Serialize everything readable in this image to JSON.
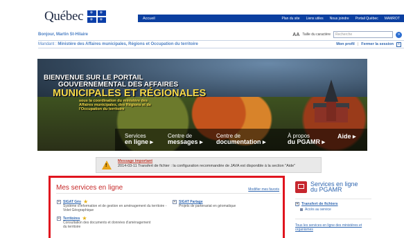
{
  "header": {
    "logo_text": "Québec",
    "home": "Accueil",
    "links": [
      "Plan du site",
      "Liens utiles",
      "Nous joindre",
      "Portail Québec",
      "MAMROT"
    ]
  },
  "userbar": {
    "greeting": "Bonjour, Martin St-Hilaire",
    "font_size_icon": "AA",
    "font_size_label": "Taille du caractère",
    "search_placeholder": "Recherche",
    "search_go": "»"
  },
  "mandat": {
    "label": "Mandant :",
    "value": "Ministère des Affaires municipales, Régions et Occupation du territoire",
    "mon_profil": "Mon profil",
    "fermer": "Fermer la session",
    "close_glyph": "x"
  },
  "banner": {
    "line1": "BIENVENUE SUR LE PORTAIL",
    "line2": "GOUVERNEMENTAL DES AFFAIRES",
    "line3": "MUNICIPALES ET RÉGIONALES",
    "sub": "sous la coordination du ministère des Affaires municipales, des Régions et de l'Occupation du territoire",
    "nav": [
      {
        "top": "Services",
        "bottom": "en ligne",
        "arrow": "▸"
      },
      {
        "top": "Centre de",
        "bottom": "messages",
        "arrow": "▸"
      },
      {
        "top": "Centre de",
        "bottom": "documentation",
        "arrow": "▸"
      },
      {
        "top": "À propos",
        "bottom": "du PGAMR",
        "arrow": "▸"
      },
      {
        "top": "",
        "bottom": "Aide",
        "arrow": "▸"
      }
    ]
  },
  "alert": {
    "title": "Message important",
    "text": "2014-03-11 Transfert de fichier : la configuration recommandée de JAVA est disponible à la section \"Aide\"",
    "icon": "!"
  },
  "services": {
    "title": "Mes services en ligne",
    "modify": "Modifier mes favoris",
    "items": [
      {
        "name": "SIGAT Géo",
        "desc": "Système d'information et de gestion en aménagement du territoire - Volet Géographique",
        "favorite": true
      },
      {
        "name": "SIGAT Partage",
        "desc": "Projets de partenariat en géomatique",
        "favorite": false
      },
      {
        "name": "Territoires",
        "desc": "Consultation des documents et données d'aménagement du territoire",
        "favorite": true
      }
    ],
    "plus_glyph": "+",
    "star_glyph": "★"
  },
  "right": {
    "title_top": "Services en ligne",
    "title_bottom": "du PGAMR",
    "item": "Transfert de fichiers",
    "sub": "Accès au service",
    "all_link": "Tous les services en ligne des ministères et organismes"
  }
}
